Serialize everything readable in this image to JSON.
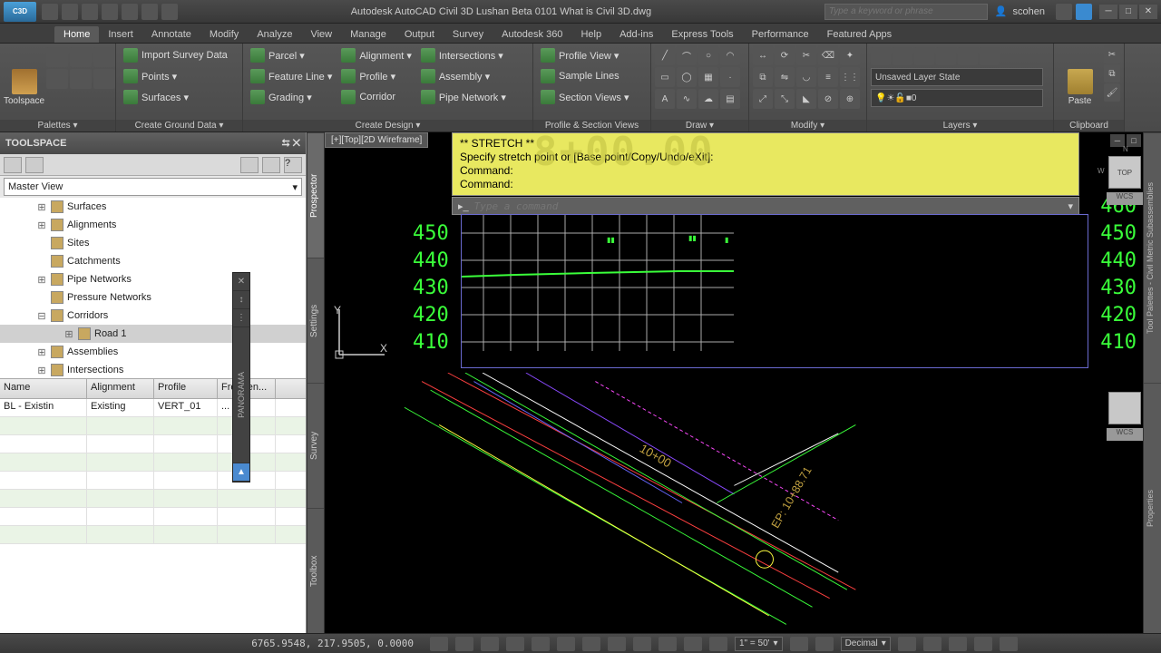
{
  "title": "Autodesk AutoCAD Civil 3D Lushan Beta   0101 What is Civil 3D.dwg",
  "search_placeholder": "Type a keyword or phrase",
  "user": "scohen",
  "app_icon_text": "C3D",
  "ribbon_tabs": [
    "Home",
    "Insert",
    "Annotate",
    "Modify",
    "Analyze",
    "View",
    "Manage",
    "Output",
    "Survey",
    "Autodesk 360",
    "Help",
    "Add-ins",
    "Express Tools",
    "Performance",
    "Featured Apps"
  ],
  "active_tab": "Home",
  "panels": {
    "palettes": {
      "label": "Palettes ▾",
      "big": "Toolspace"
    },
    "ground": {
      "label": "Create Ground Data ▾",
      "items": [
        "Import Survey Data",
        "Points ▾",
        "Surfaces ▾"
      ]
    },
    "design": {
      "label": "Create Design ▾",
      "col1": [
        "Parcel ▾",
        "Feature Line ▾",
        "Grading ▾"
      ],
      "col2": [
        "Alignment ▾",
        "Profile ▾",
        "Corridor"
      ],
      "col3": [
        "Intersections ▾",
        "Assembly ▾",
        "Pipe Network ▾"
      ]
    },
    "profile": {
      "label": "Profile & Section Views",
      "items": [
        "Profile View ▾",
        "Sample Lines",
        "Section Views ▾"
      ]
    },
    "draw": {
      "label": "Draw ▾"
    },
    "modify": {
      "label": "Modify ▾"
    },
    "layers": {
      "label": "Layers ▾",
      "state": "Unsaved Layer State",
      "current": "0"
    },
    "clipboard": {
      "label": "Clipboard",
      "big": "Paste"
    }
  },
  "toolspace": {
    "title": "TOOLSPACE",
    "view": "Master View",
    "tabs": [
      "Prospector",
      "Settings",
      "Survey",
      "Toolbox"
    ],
    "tree": [
      {
        "label": "Surfaces",
        "exp": "+"
      },
      {
        "label": "Alignments",
        "exp": "+"
      },
      {
        "label": "Sites",
        "exp": ""
      },
      {
        "label": "Catchments",
        "exp": ""
      },
      {
        "label": "Pipe Networks",
        "exp": "+"
      },
      {
        "label": "Pressure Networks",
        "exp": ""
      },
      {
        "label": "Corridors",
        "exp": "-",
        "children": [
          {
            "label": "Road 1",
            "exp": "+",
            "sel": true
          }
        ]
      },
      {
        "label": "Assemblies",
        "exp": "+"
      },
      {
        "label": "Intersections",
        "exp": "+"
      }
    ],
    "grid_headers": [
      "Name",
      "Alignment",
      "Profile",
      "Frequen..."
    ],
    "grid_row": {
      "name": "BL - Existin",
      "align": "Existing",
      "profile": "VERT_01",
      "freq": "..."
    }
  },
  "viewport": {
    "tab": "[+][Top][2D Wireframe]",
    "cmd_history": [
      "** STRETCH **",
      "Specify stretch point or [Base point/Copy/Undo/eXit]:",
      "Command:",
      "Command:"
    ],
    "cmd_placeholder": "Type a command",
    "station_overlay": "8+00.00",
    "profile_left": [
      "450",
      "440",
      "430",
      "420",
      "410"
    ],
    "profile_right": [
      "460",
      "450",
      "440",
      "430",
      "420",
      "410"
    ],
    "plan_labels": [
      "10+00",
      "EP: 10+88.71"
    ],
    "wcs": "WCS",
    "cube": "TOP"
  },
  "statusbar": {
    "coords": "6765.9548, 217.9505, 0.0000",
    "scale": "1\" = 50'",
    "units": "Decimal"
  },
  "right_tabs": [
    "Tool Palettes - Civil Metric Subassemblies",
    "Properties"
  ],
  "panorama": "PANORAMA"
}
